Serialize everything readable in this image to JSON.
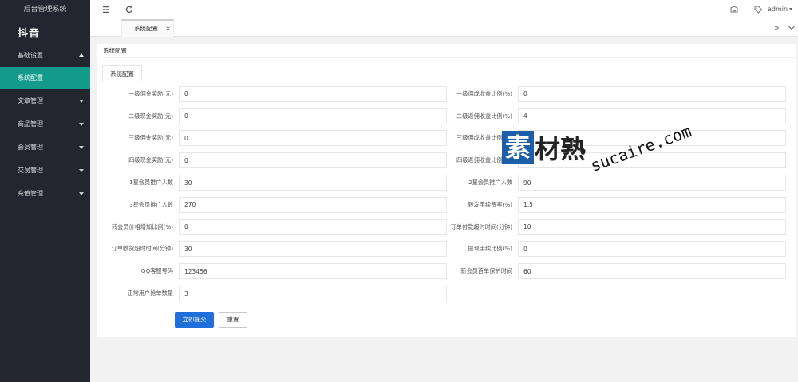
{
  "app": {
    "title": "后台管理系统",
    "logo_text": "抖音"
  },
  "sidebar": {
    "items": [
      {
        "label": "基础设置",
        "expanded": true
      },
      {
        "label": "系统配置",
        "active": true
      },
      {
        "label": "文章管理"
      },
      {
        "label": "商品管理"
      },
      {
        "label": "会员管理"
      },
      {
        "label": "交易管理"
      },
      {
        "label": "充值管理"
      }
    ]
  },
  "header": {
    "icons": [
      "menu-icon",
      "refresh-icon",
      "theme-icon",
      "tag-icon"
    ],
    "user": "admin"
  },
  "tabs": [
    {
      "label": "系统配置",
      "close": "×"
    }
  ],
  "tabbar_controls": {
    "more": "»"
  },
  "card": {
    "title": "系统配置",
    "tab": "系统配置"
  },
  "form": {
    "rows": [
      {
        "left": {
          "label": "一级佣金奖励(元)",
          "value": "0"
        },
        "right": {
          "label": "一级佣成收益比例(%)",
          "value": "0"
        }
      },
      {
        "left": {
          "label": "二级现金奖励(元)",
          "value": "0"
        },
        "right": {
          "label": "二级返佣收益比例(%)",
          "value": "4"
        }
      },
      {
        "left": {
          "label": "三级佣金奖励(元)",
          "value": "0"
        },
        "right": {
          "label": "三级佣成收益比例(%)",
          "value": ""
        }
      },
      {
        "left": {
          "label": "四级现金奖励(元)",
          "value": "0"
        },
        "right": {
          "label": "四级返佣收益比例(%)",
          "value": ""
        }
      },
      {
        "left": {
          "label": "1星会员推广人数",
          "value": "30"
        },
        "right": {
          "label": "2星会员推广人数",
          "value": "90"
        }
      },
      {
        "left": {
          "label": "3星会员推广人数",
          "value": "270"
        },
        "right": {
          "label": "转发手续费率(%)",
          "value": "1.5"
        }
      },
      {
        "left": {
          "label": "转会员价格增加比例(%)",
          "value": "0"
        },
        "right": {
          "label": "订单付款超时时间(分钟)",
          "value": "10"
        }
      },
      {
        "left": {
          "label": "订单收货超时时间(分钟)",
          "value": "30"
        },
        "right": {
          "label": "提现手续比例(%)",
          "value": "0"
        }
      },
      {
        "left": {
          "label": "QQ客服号码",
          "value": "123456"
        },
        "right": {
          "label": "新会员首单保护时间",
          "value": "60"
        }
      },
      {
        "left": {
          "label": "正常用户抢单数量",
          "value": "3"
        }
      }
    ]
  },
  "buttons": {
    "submit": "立即提交",
    "reset": "重置"
  },
  "watermark": {
    "mark": "素",
    "text": "材熟",
    "url": "sucaire.com"
  },
  "colors": {
    "sidebar_bg": "#23262e",
    "active": "#139a8b",
    "primary": "#1e6fd9",
    "watermark": "#1c5ea8"
  }
}
